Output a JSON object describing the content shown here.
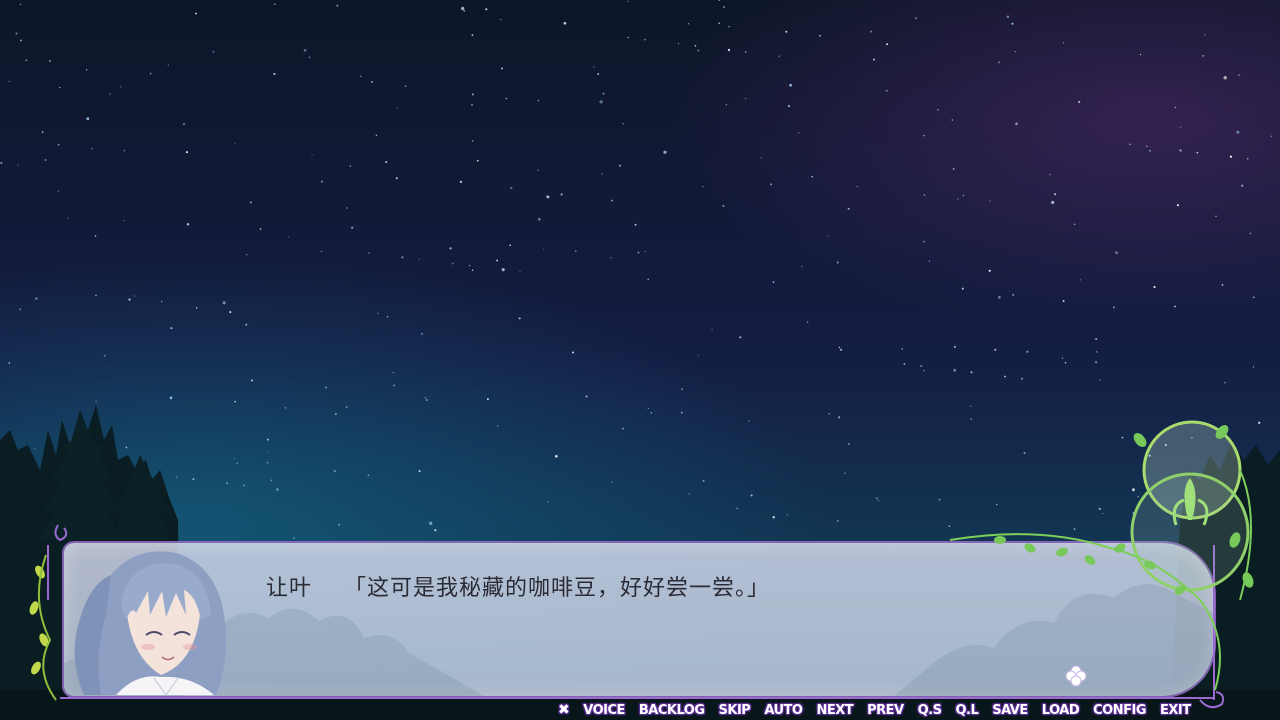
{
  "dialogue": {
    "speaker": "让叶",
    "text": "「这可是我秘藏的咖啡豆，好好尝一尝。」"
  },
  "menu": {
    "close_glyph": "✖",
    "items": [
      "VOICE",
      "BACKLOG",
      "SKIP",
      "AUTO",
      "NEXT",
      "PREV",
      "Q.S",
      "Q.L",
      "SAVE",
      "LOAD",
      "CONFIG",
      "EXIT"
    ]
  },
  "icons": {
    "clover": "clover-icon",
    "close": "close-icon"
  },
  "colors": {
    "menu_text": "#ffffff",
    "menu_outline": "#6a3aa8",
    "frame_accent": "#9a6ad0",
    "dialogue_text": "#2b2b36"
  }
}
